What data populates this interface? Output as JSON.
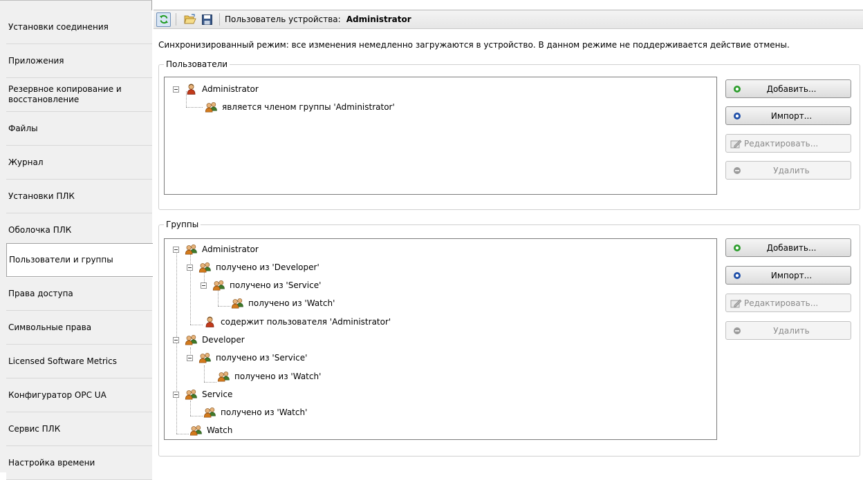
{
  "sidebar": {
    "items": [
      {
        "label": "Установки соединения"
      },
      {
        "label": "Приложения"
      },
      {
        "label": "Резервное копирование и восстановление"
      },
      {
        "label": "Файлы"
      },
      {
        "label": "Журнал"
      },
      {
        "label": "Установки ПЛК"
      },
      {
        "label": "Оболочка ПЛК"
      },
      {
        "label": "Пользователи и группы"
      },
      {
        "label": "Права доступа"
      },
      {
        "label": "Символьные права"
      },
      {
        "label": "Licensed Software Metrics"
      },
      {
        "label": "Конфигуратор OPC UA"
      },
      {
        "label": "Сервис ПЛК"
      },
      {
        "label": "Настройка времени"
      }
    ],
    "active_item": "Пользователи и группы"
  },
  "toolbar": {
    "icons": [
      "sync-icon",
      "open-folder-icon",
      "save-icon"
    ],
    "device_user_label": "Пользователь устройства:",
    "device_user_value": "Administrator"
  },
  "sync_info": "Синхронизированный режим: все изменения немедленно загружаются в устройство. В данном режиме не поддерживается действие отмены.",
  "users": {
    "title": "Пользователи",
    "tree": [
      {
        "label": "Administrator",
        "icon": "user-icon"
      },
      {
        "label": "является членом группы 'Administrator'",
        "icon": "group-icon"
      }
    ],
    "buttons": {
      "add": "Добавить...",
      "import": "Импорт...",
      "edit": "Редактировать...",
      "delete": "Удалить"
    }
  },
  "groups": {
    "title": "Группы",
    "tree": [
      {
        "label": "Administrator",
        "icon": "group-icon"
      },
      {
        "label": "получено из 'Developer'",
        "icon": "group-icon"
      },
      {
        "label": "получено из 'Service'",
        "icon": "group-icon"
      },
      {
        "label": "получено из 'Watch'",
        "icon": "group-icon"
      },
      {
        "label": "содержит пользователя 'Administrator'",
        "icon": "user-icon"
      },
      {
        "label": "Developer",
        "icon": "group-icon"
      },
      {
        "label": "получено из 'Service'",
        "icon": "group-icon"
      },
      {
        "label": "получено из 'Watch'",
        "icon": "group-icon"
      },
      {
        "label": "Service",
        "icon": "group-icon"
      },
      {
        "label": "получено из 'Watch'",
        "icon": "group-icon"
      },
      {
        "label": "Watch",
        "icon": "group-icon"
      }
    ],
    "buttons": {
      "add": "Добавить...",
      "import": "Импорт...",
      "edit": "Редактировать...",
      "delete": "Удалить"
    }
  },
  "colors": {
    "add_icon": "#2e9e2e",
    "import_icon": "#1f4fa8",
    "disabled_text": "#8a8a8a",
    "sidebar_bg": "#f0f0f0"
  }
}
